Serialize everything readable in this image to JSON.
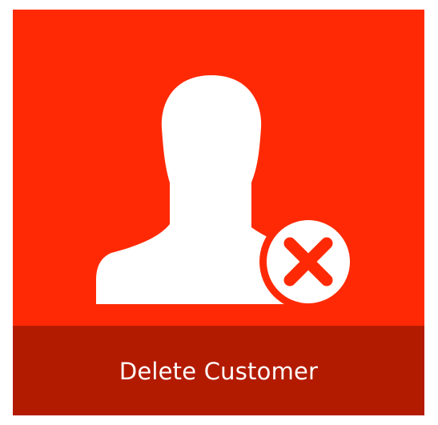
{
  "tile": {
    "label": "Delete Customer",
    "colors": {
      "background": "#ff2a05",
      "footer": "#b31b00",
      "icon": "#ffffff",
      "badge_cross": "#ff2a05"
    },
    "icons": [
      "user-silhouette-icon",
      "delete-x-icon"
    ]
  }
}
